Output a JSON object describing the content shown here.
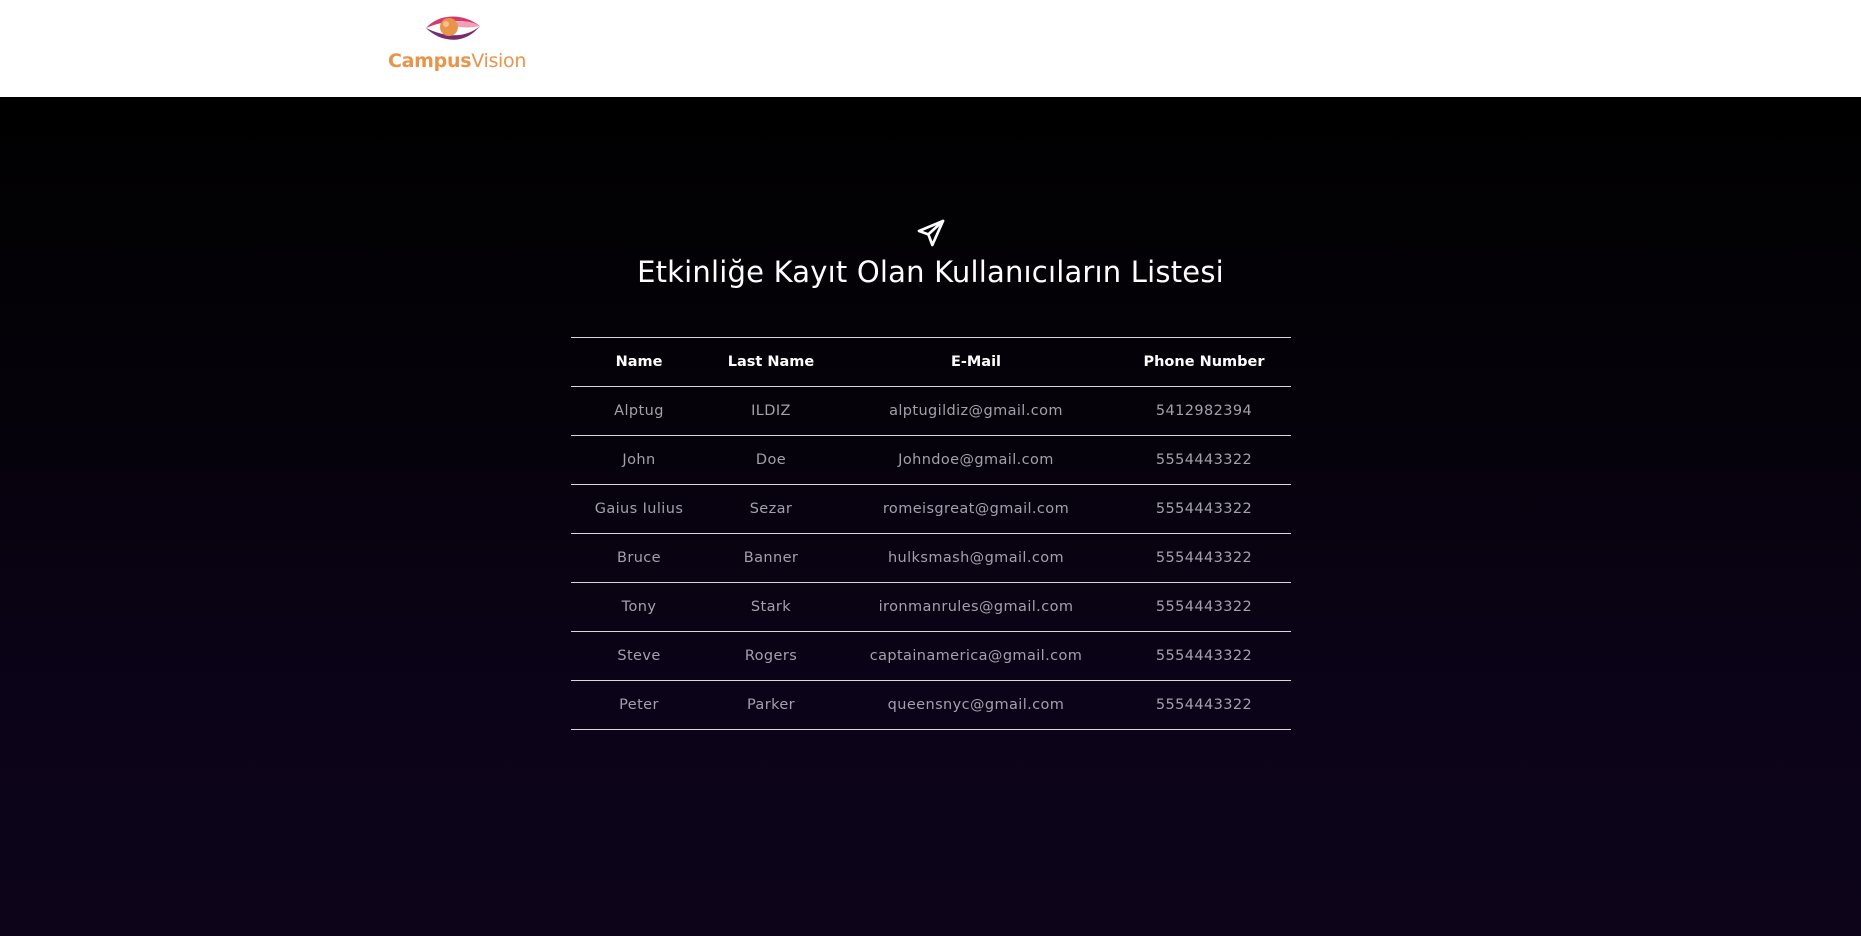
{
  "header": {
    "logo": {
      "text_bold": "Campus",
      "text_light": "Vision",
      "colors": {
        "orange": "#e8944a",
        "pink": "#d63a6a",
        "purple": "#7a2b6e"
      }
    }
  },
  "page": {
    "icon": "paper-plane-icon",
    "title": "Etkinliğe Kayıt Olan Kullanıcıların Listesi"
  },
  "table": {
    "headers": [
      "Name",
      "Last Name",
      "E-Mail",
      "Phone Number"
    ],
    "rows": [
      [
        "Alptug",
        "ILDIZ",
        "alptugildiz@gmail.com",
        "5412982394"
      ],
      [
        "John",
        "Doe",
        "Johndoe@gmail.com",
        "5554443322"
      ],
      [
        "Gaius Iulius",
        "Sezar",
        "romeisgreat@gmail.com",
        "5554443322"
      ],
      [
        "Bruce",
        "Banner",
        "hulksmash@gmail.com",
        "5554443322"
      ],
      [
        "Tony",
        "Stark",
        "ironmanrules@gmail.com",
        "5554443322"
      ],
      [
        "Steve",
        "Rogers",
        "captainamerica@gmail.com",
        "5554443322"
      ],
      [
        "Peter",
        "Parker",
        "queensnyc@gmail.com",
        "5554443322"
      ]
    ]
  },
  "colors": {
    "header_bg": "#ffffff",
    "main_bg_top": "#000000",
    "main_bg_bottom": "#0d0419",
    "heading_text": "#ffffff",
    "cell_text": "#a3a0ab",
    "row_border": "#d8d8d8"
  }
}
